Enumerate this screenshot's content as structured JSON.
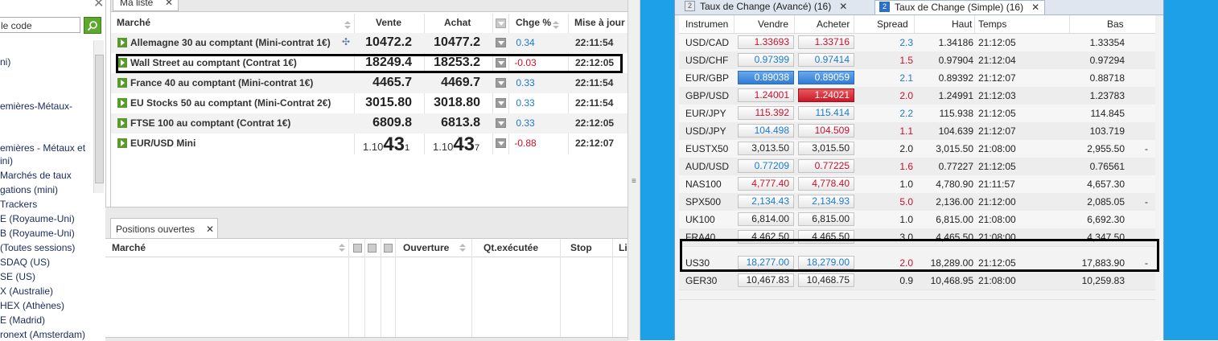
{
  "left": {
    "search_placeholder": "le code",
    "items": [
      {
        "label": "ni)"
      },
      {
        "label": "emières-Métaux-"
      },
      {
        "label": "emières - Métaux et"
      },
      {
        "label": "ini)"
      },
      {
        "label": "Marchés de taux"
      },
      {
        "label": "gations (mini)"
      },
      {
        "label": "Trackers"
      },
      {
        "label": "E (Royaume-Uni)"
      },
      {
        "label": "B (Royaume-Uni)"
      },
      {
        "label": "(Toutes sessions)"
      },
      {
        "label": "SDAQ (US)"
      },
      {
        "label": "SE (US)"
      },
      {
        "label": "X (Australie)"
      },
      {
        "label": "HEX (Athènes)"
      },
      {
        "label": "E (Madrid)"
      },
      {
        "label": "ronext (Amsterdam)"
      }
    ]
  },
  "watchlist": {
    "tab_label": "Ma liste",
    "columns": {
      "market": "Marché",
      "sell": "Vente",
      "buy": "Achat",
      "change": "Chge %",
      "updated": "Mise à jour"
    },
    "rows": [
      {
        "name": "Allemagne 30 au comptant (Mini-contrat 1€)",
        "sell": "10472.2",
        "buy": "10477.2",
        "change": "0.34",
        "time": "22:11:54",
        "dir": "pos"
      },
      {
        "name": "Wall Street au comptant (Contrat 1€)",
        "sell": "18249.4",
        "buy": "18253.2",
        "change": "-0.03",
        "time": "22:12:05",
        "dir": "neg"
      },
      {
        "name": "France 40 au comptant (Mini-contrat 1€)",
        "sell": "4465.7",
        "buy": "4469.7",
        "change": "0.33",
        "time": "22:11:54",
        "dir": "pos"
      },
      {
        "name": "EU Stocks 50 au comptant (Mini-Contrat 2€)",
        "sell": "3015.80",
        "buy": "3018.80",
        "change": "0.33",
        "time": "22:11:54",
        "dir": "pos"
      },
      {
        "name": "FTSE 100 au comptant (Contrat 1€)",
        "sell": "6809.8",
        "buy": "6813.8",
        "change": "0.33",
        "time": "22:12:05",
        "dir": "pos"
      }
    ],
    "eurusd": {
      "name": "EUR/USD Mini",
      "sell": {
        "prefix": "1.10",
        "big": "43",
        "pip": "1"
      },
      "buy": {
        "prefix": "1.10",
        "big": "43",
        "pip": "7"
      },
      "change": "-0.88",
      "time": "22:12:07"
    }
  },
  "positions": {
    "tab_label": "Positions ouvertes",
    "columns": {
      "market": "Marché",
      "opening": "Ouverture",
      "qty": "Qt.exécutée",
      "stop": "Stop",
      "limit": "Li"
    }
  },
  "fx": {
    "tabs": [
      {
        "num": "2",
        "label": "Taux de Change (Avancé) (16)"
      },
      {
        "num": "2",
        "label": "Taux de Change (Simple) (16)"
      }
    ],
    "columns": {
      "instrument": "Instrumen",
      "sell": "Vendre",
      "buy": "Acheter",
      "spread": "Spread",
      "high": "Haut",
      "time": "Temps",
      "low": "Bas"
    },
    "rows": [
      {
        "sym": "USD/CAD",
        "sell": "1.33693",
        "buy": "1.33716",
        "spread": "2.3",
        "high": "1.34186",
        "time": "21:12:05",
        "low": "1.33354",
        "sellc": "c-red",
        "buyc": "c-red",
        "sprc": "c-blue",
        "extra": ""
      },
      {
        "sym": "USD/CHF",
        "sell": "0.97399",
        "buy": "0.97414",
        "spread": "1.5",
        "high": "0.97904",
        "time": "21:12:04",
        "low": "0.97294",
        "sellc": "c-blue",
        "buyc": "c-blue",
        "sprc": "c-red",
        "extra": ""
      },
      {
        "sym": "EUR/GBP",
        "sell": "0.89038",
        "buy": "0.89059",
        "spread": "2.1",
        "high": "0.89392",
        "time": "21:12:07",
        "low": "0.88718",
        "sellc": "blue-hi",
        "buyc": "blue-hi",
        "sprc": "c-blue",
        "extra": ""
      },
      {
        "sym": "GBP/USD",
        "sell": "1.24001",
        "buy": "1.24021",
        "spread": "2.0",
        "high": "1.24991",
        "time": "21:12:03",
        "low": "1.23783",
        "sellc": "c-red",
        "buyc": "red-hi",
        "sprc": "c-red",
        "extra": ""
      },
      {
        "sym": "EUR/JPY",
        "sell": "115.392",
        "buy": "115.414",
        "spread": "2.2",
        "high": "115.938",
        "time": "21:12:05",
        "low": "114.845",
        "sellc": "c-red",
        "buyc": "c-blue",
        "sprc": "c-blue",
        "extra": ""
      },
      {
        "sym": "USD/JPY",
        "sell": "104.498",
        "buy": "104.509",
        "spread": "1.1",
        "high": "104.639",
        "time": "21:12:07",
        "low": "103.719",
        "sellc": "c-blue",
        "buyc": "c-red",
        "sprc": "c-red",
        "extra": ""
      },
      {
        "sym": "EUSTX50",
        "sell": "3,013.50",
        "buy": "3,015.50",
        "spread": "2.0",
        "high": "3,015.50",
        "time": "21:08:00",
        "low": "2,955.50",
        "sellc": "c-dark",
        "buyc": "c-dark",
        "sprc": "c-dark",
        "extra": "-"
      },
      {
        "sym": "AUD/USD",
        "sell": "0.77209",
        "buy": "0.77225",
        "spread": "1.6",
        "high": "0.77227",
        "time": "21:12:05",
        "low": "0.76561",
        "sellc": "c-blue",
        "buyc": "c-red",
        "sprc": "c-red",
        "extra": ""
      },
      {
        "sym": "NAS100",
        "sell": "4,777.40",
        "buy": "4,778.40",
        "spread": "1.0",
        "high": "4,780.90",
        "time": "21:11:57",
        "low": "4,657.30",
        "sellc": "c-red",
        "buyc": "c-red",
        "sprc": "c-dark",
        "extra": ""
      },
      {
        "sym": "SPX500",
        "sell": "2,134.43",
        "buy": "2,134.93",
        "spread": "5.0",
        "high": "2,136.00",
        "time": "21:12:00",
        "low": "2,085.05",
        "sellc": "c-blue",
        "buyc": "c-blue",
        "sprc": "c-red",
        "extra": "-"
      },
      {
        "sym": "UK100",
        "sell": "6,814.00",
        "buy": "6,815.00",
        "spread": "1.0",
        "high": "6,815.00",
        "time": "21:08:00",
        "low": "6,692.30",
        "sellc": "c-dark",
        "buyc": "c-dark",
        "sprc": "c-dark",
        "extra": ""
      },
      {
        "sym": "FRA40",
        "sell": "4,462.50",
        "buy": "4,465.50",
        "spread": "3.0",
        "high": "4,465.50",
        "time": "21:08:00",
        "low": "4,347.50",
        "sellc": "c-dark",
        "buyc": "c-dark",
        "sprc": "c-dark",
        "extra": ""
      },
      {
        "sym": "US30",
        "sell": "18,277.00",
        "buy": "18,279.00",
        "spread": "2.0",
        "high": "18,289.00",
        "time": "21:12:05",
        "low": "17,883.90",
        "sellc": "c-blue",
        "buyc": "c-blue",
        "sprc": "c-red",
        "extra": "-"
      },
      {
        "sym": "GER30",
        "sell": "10,467.83",
        "buy": "10,468.75",
        "spread": "0.9",
        "high": "10,468.95",
        "time": "21:08:00",
        "low": "10,259.83",
        "sellc": "c-dark",
        "buyc": "c-dark",
        "sprc": "c-dark",
        "extra": ""
      }
    ]
  }
}
